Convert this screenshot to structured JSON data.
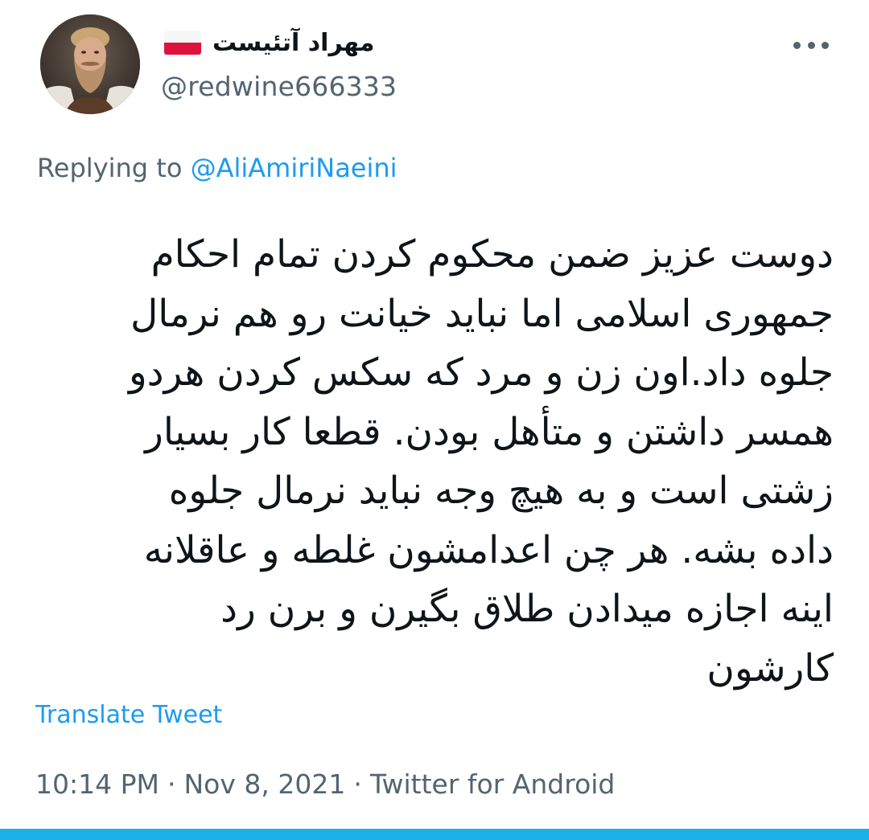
{
  "author": {
    "display_name": "مهراد آتئیست",
    "handle": "@redwine666333",
    "flag_icon": "poland-flag-icon",
    "avatar_icon": "bearded-man-avatar"
  },
  "reply": {
    "prefix": "Replying to ",
    "mention": "@AliAmiriNaeini"
  },
  "tweet": {
    "lines": [
      "دوست عزیز ضمن محکوم کردن تمام احکام",
      "جمهوری اسلامی اما نباید خیانت رو هم نرمال",
      "جلوه داد.اون زن و مرد که سکس کردن هردو",
      "همسر داشتن و متأهل بودن. قطعا کار بسیار",
      "زشتی است و به هیچ وجه نباید نرمال جلوه",
      "داده بشه. هر چن اعدامشون غلطه و عاقلانه",
      "اینه اجازه میدادن طلاق بگیرن و برن رد",
      "کارشون"
    ]
  },
  "translate_label": "Translate Tweet",
  "meta": {
    "time": "10:14 PM",
    "separator": "·",
    "date": "Nov 8, 2021",
    "source": "Twitter for Android"
  },
  "colors": {
    "link": "#1d9bf0",
    "muted": "#536471",
    "text": "#0f1419",
    "accent_bar": "#1ab2e8"
  },
  "icons": {
    "more": "more-horizontal-icon"
  }
}
